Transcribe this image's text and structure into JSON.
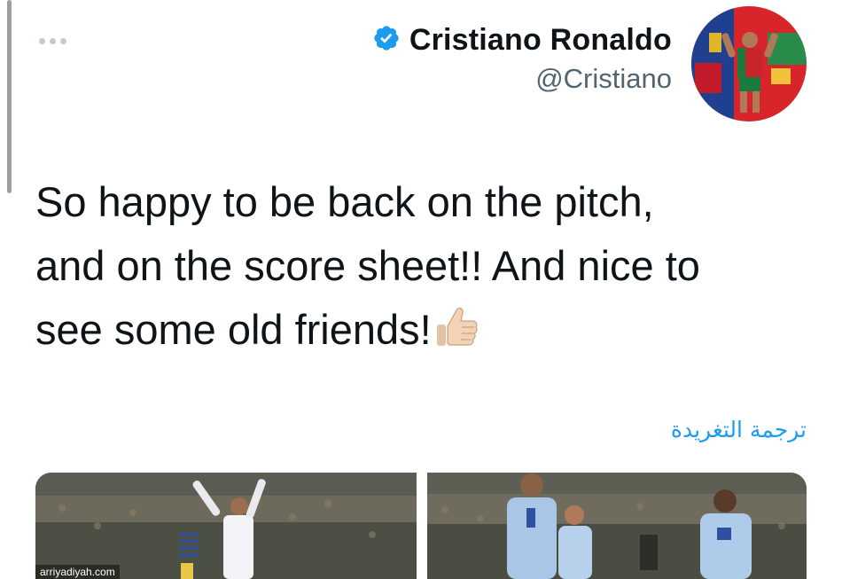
{
  "tweet": {
    "author_name": "Cristiano Ronaldo",
    "author_handle": "@Cristiano",
    "verified": true,
    "text": "So happy to be back on the pitch,\nand on the score sheet!! And nice to\nsee some old friends!",
    "emoji": "thumbs-up (light skin tone)",
    "translate_label": "ترجمة التغريدة"
  },
  "media": {
    "photos": [
      {
        "description": "player in white kit number 7 celebrating"
      },
      {
        "description": "players in light blue kits celebrating in stadium"
      }
    ]
  },
  "watermark": "arriyadiyah.com",
  "colors": {
    "text": "#0f1419",
    "secondary": "#536471",
    "accent": "#1d9bf0",
    "verified": "#1d9bf0"
  },
  "icons": [
    "more-icon",
    "verified-badge-icon",
    "thumbs-up-icon"
  ]
}
